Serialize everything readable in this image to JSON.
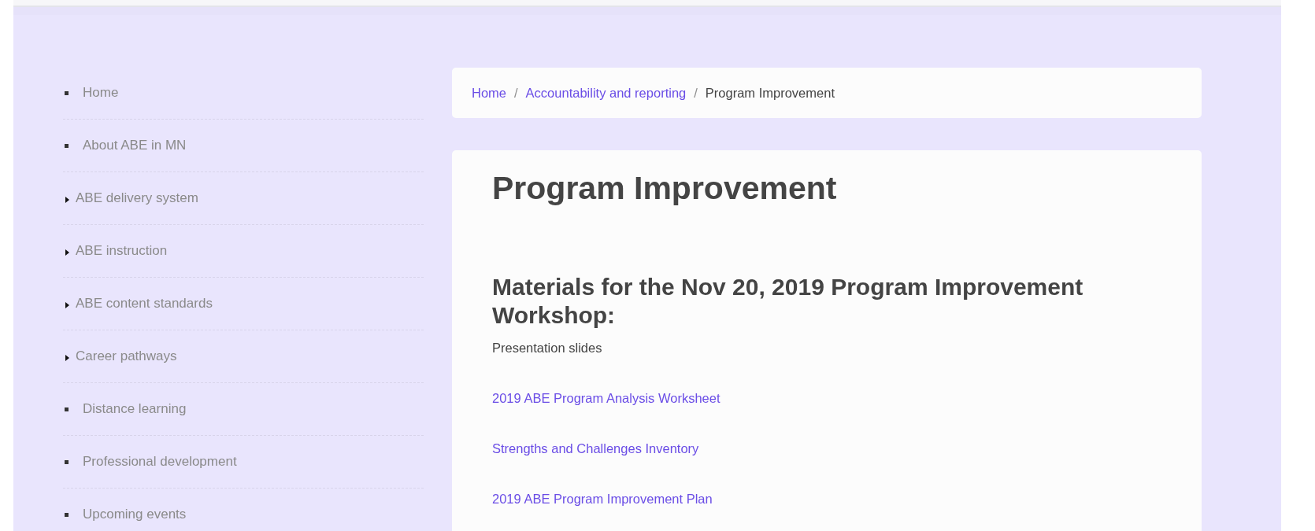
{
  "sidebar": {
    "items": [
      {
        "label": "Home",
        "kind": "leaf"
      },
      {
        "label": "About ABE in MN",
        "kind": "leaf"
      },
      {
        "label": "ABE delivery system",
        "kind": "expandable"
      },
      {
        "label": "ABE instruction",
        "kind": "expandable"
      },
      {
        "label": "ABE content standards",
        "kind": "expandable"
      },
      {
        "label": "Career pathways",
        "kind": "expandable"
      },
      {
        "label": "Distance learning",
        "kind": "leaf"
      },
      {
        "label": "Professional development",
        "kind": "leaf"
      },
      {
        "label": "Upcoming events",
        "kind": "leaf"
      }
    ]
  },
  "breadcrumb": [
    {
      "label": "Home",
      "kind": "link"
    },
    {
      "label": "Accountability and reporting",
      "kind": "link",
      "separator": "/"
    },
    {
      "label": "Program Improvement",
      "kind": "current",
      "separator": "/"
    }
  ],
  "content": {
    "title": "Program Improvement",
    "subtitle": "Materials for the Nov 20, 2019 Program Improvement Workshop:",
    "entries": [
      {
        "text": "Presentation slides",
        "kind": "text"
      },
      {
        "text": "2019 ABE Program Analysis Worksheet",
        "kind": "link"
      },
      {
        "text": "Strengths and Challenges Inventory",
        "kind": "link"
      },
      {
        "text": "2019 ABE Program Improvement Plan",
        "kind": "link"
      }
    ]
  }
}
